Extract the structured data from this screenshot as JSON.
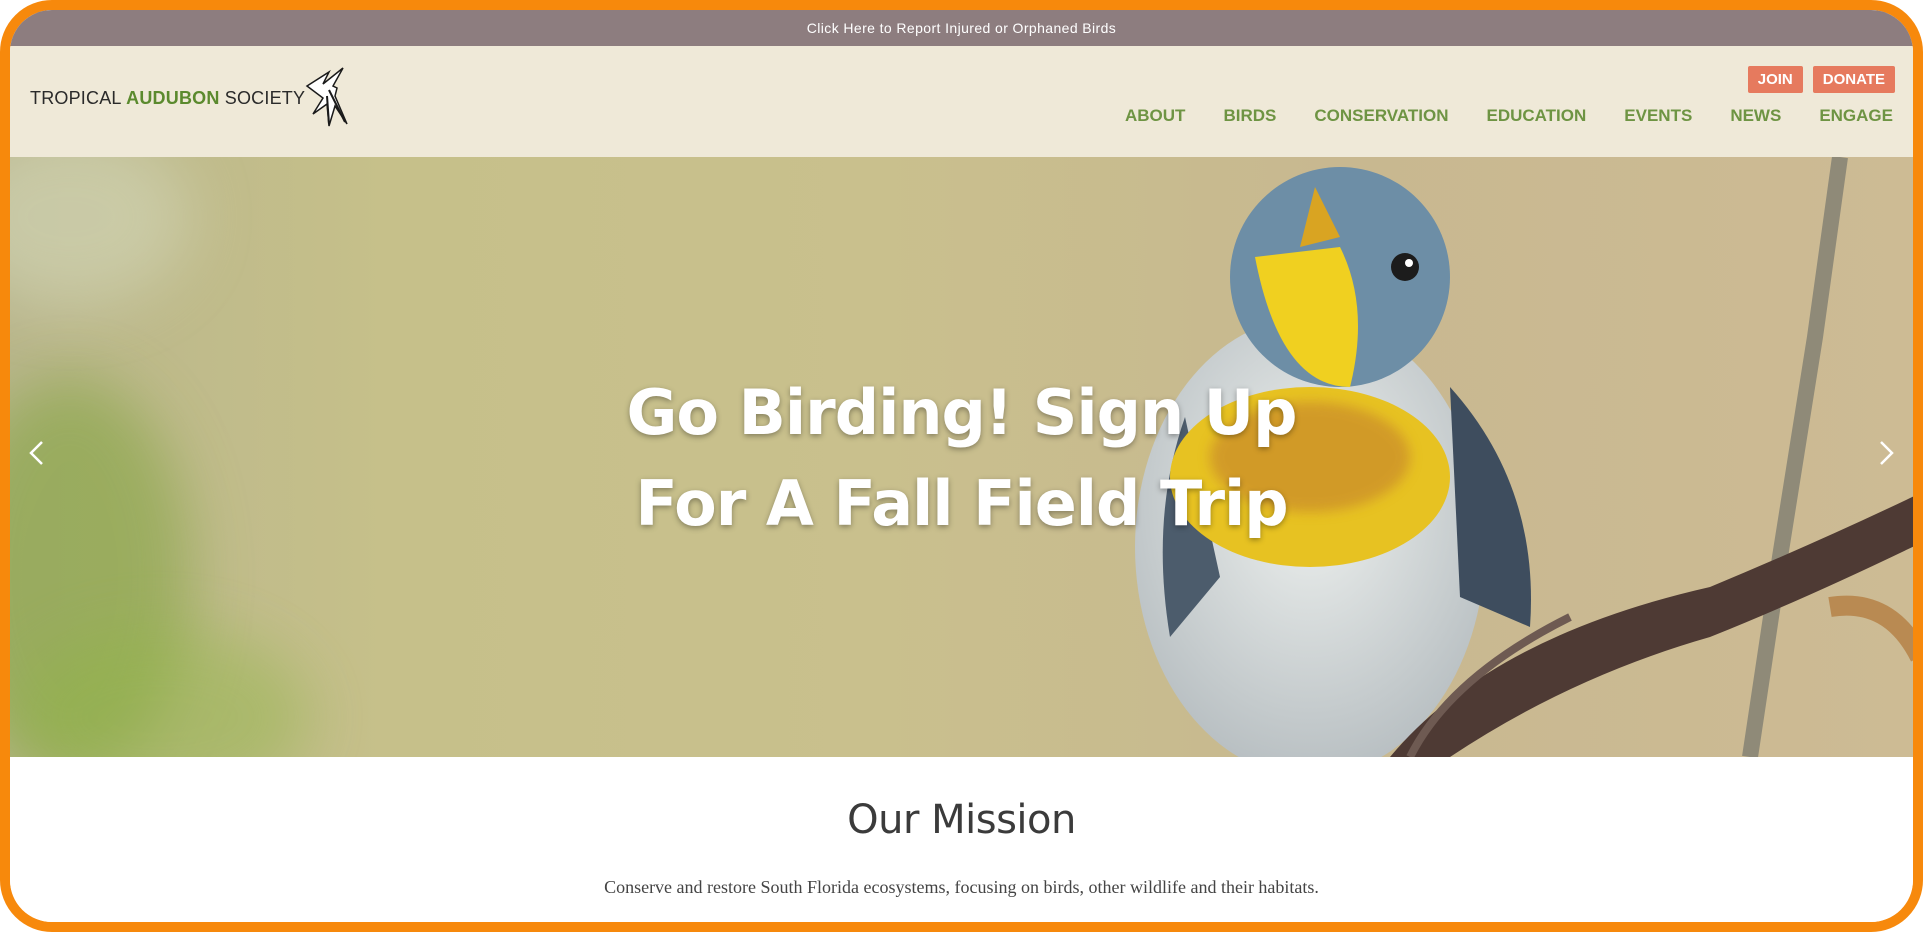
{
  "topbar": {
    "report_link": "Click Here to Report Injured or Orphaned Birds"
  },
  "logo": {
    "word1": "TROPICAL",
    "word2": "AUDUBON",
    "word3": "SOCIETY",
    "icon": "swallow-bird-icon"
  },
  "utility": {
    "join": "JOIN",
    "donate": "DONATE"
  },
  "nav": {
    "items": [
      "ABOUT",
      "BIRDS",
      "CONSERVATION",
      "EDUCATION",
      "EVENTS",
      "NEWS",
      "ENGAGE"
    ]
  },
  "hero": {
    "line1": "Go Birding! Sign Up",
    "line2": "For A Fall Field Trip",
    "prev_icon": "chevron-left-icon",
    "next_icon": "chevron-right-icon"
  },
  "mission": {
    "title": "Our Mission",
    "text": "Conserve and restore South Florida ecosystems, focusing on birds, other wildlife and their habitats."
  },
  "colors": {
    "frame": "#f7890c",
    "topbar": "#8d7d7f",
    "header": "#efe9d8",
    "accent_green": "#6e9443",
    "button": "#e67a5e"
  }
}
